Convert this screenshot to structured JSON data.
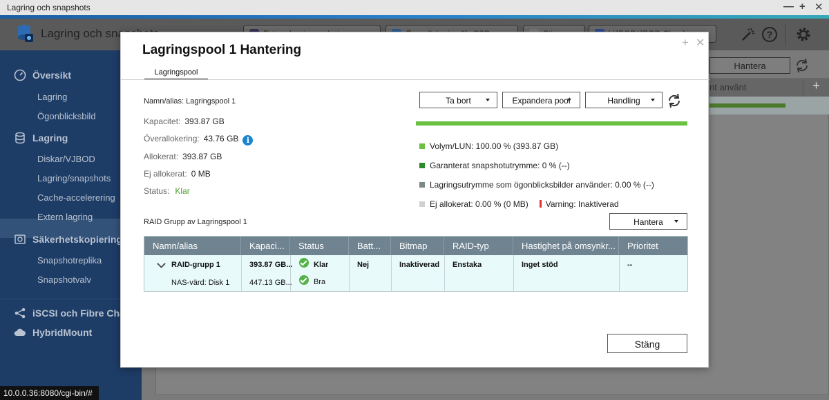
{
  "window": {
    "title": "Lagring och snapshots",
    "controls": [
      "—",
      "+",
      "✕"
    ]
  },
  "header": {
    "app_title": "Lagring och snapshots",
    "buttons": [
      "Extern lagringsenhet",
      "Överallokering för SSD",
      "Stig",
      "VJBOD/JBOD Cloud"
    ],
    "hantera_label": "Hantera"
  },
  "sidebar": {
    "sections": [
      {
        "label": "Översikt",
        "icon": "speedometer-icon",
        "items": [
          "Lagring",
          "Ögonblicksbild"
        ]
      },
      {
        "label": "Lagring",
        "icon": "database-icon",
        "items": [
          "Diskar/VJBOD",
          "Lagring/snapshots",
          "Cache-accelerering",
          "Extern lagring"
        ]
      },
      {
        "label": "Säkerhetskopiering av snapshots",
        "icon": "backup-icon",
        "items": [
          "Snapshotreplika",
          "Snapshotvalv"
        ]
      },
      {
        "label": "iSCSI och Fibre Channel",
        "icon": "share-icon",
        "items": []
      },
      {
        "label": "HybridMount",
        "icon": "cloud-icon",
        "items": []
      }
    ],
    "active": "Lagring/snapshots"
  },
  "background_table": {
    "header": "nt använt",
    "add_label": "+"
  },
  "status_bar": {
    "url": "10.0.0.36:8080/cgi-bin/#"
  },
  "modal": {
    "title": "Lagringspool 1 Hantering",
    "tab": "Lagringspool",
    "name_alias": "Namn/alias: Lagringspool 1",
    "fields": [
      {
        "label": "Kapacitet:",
        "value": "393.87 GB"
      },
      {
        "label": "Överallokering:",
        "value": "43.76 GB"
      },
      {
        "label": "Allokerat:",
        "value": "393.87 GB"
      },
      {
        "label": "Ej allokerat:",
        "value": "0 MB"
      },
      {
        "label": "Status:",
        "value": "Klar"
      }
    ],
    "actions": [
      "Ta bort",
      "Expandera pool",
      "Handling"
    ],
    "capacity_fraction": 1.0,
    "legend": [
      {
        "text": "Volym/LUN: 100.00 % (393.87 GB)",
        "color": "#6ac13f"
      },
      {
        "text": "Garanterat snapshotutrymme: 0 % (--)",
        "color": "#2c8a2a"
      },
      {
        "text": "Lagringsutrymme som ögonblicksbilder använder: 0.00 % (--)",
        "color": "#7c8a84"
      },
      {
        "text": "Ej allokerat: 0.00 % (0 MB)",
        "color": "#d0d0d0"
      }
    ],
    "warning": "Varning: Inaktiverad",
    "warning_color": "#e03030",
    "raid_label": "RAID Grupp av Lagringspool 1",
    "raid_manage": "Hantera",
    "table": {
      "columns": [
        "Namn/alias",
        "Kapaci...",
        "Status",
        "Batt...",
        "Bitmap",
        "RAID-typ",
        "Hastighet på omsynkr...",
        "Prioritet"
      ],
      "group_row": {
        "name": "RAID-grupp 1",
        "capacity": "393.87 GB...",
        "status": "Klar",
        "battery": "Nej",
        "bitmap": "Inaktiverad",
        "raid_type": "Enstaka",
        "speed": "Inget stöd",
        "priority": "--"
      },
      "disk_row": {
        "name": "NAS-värd: Disk 1",
        "capacity": "447.13 GB...",
        "status": "Bra"
      }
    },
    "close_label": "Stäng"
  }
}
